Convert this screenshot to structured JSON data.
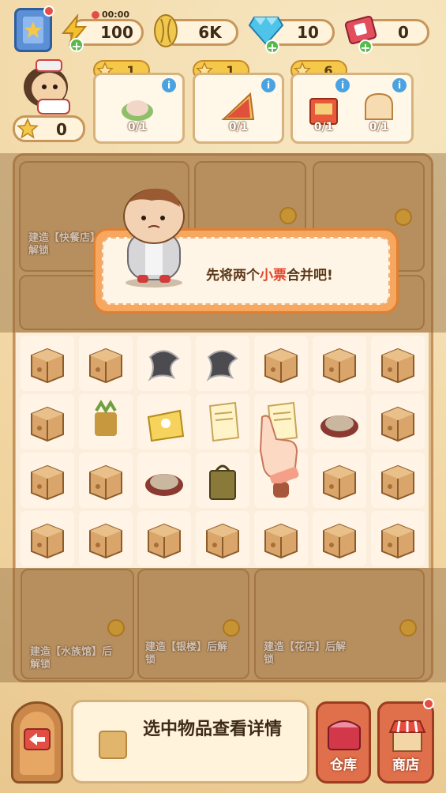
{
  "hud": {
    "energy": {
      "value": "100",
      "timer": "00:00"
    },
    "coins": {
      "value": "6K"
    },
    "gems": {
      "value": "10"
    },
    "tickets": {
      "value": "0"
    },
    "stars": {
      "value": "0"
    }
  },
  "orders": [
    {
      "stars": "1",
      "items": [
        {
          "count": "0/1"
        }
      ]
    },
    {
      "stars": "1",
      "items": [
        {
          "count": "0/1"
        }
      ]
    },
    {
      "stars": "6",
      "items": [
        {
          "count": "0/1"
        },
        {
          "count": "0/1"
        }
      ]
    }
  ],
  "locked_areas": {
    "top_left": "建造【快餐店】后解锁",
    "bottom_left": "建造【水族馆】后解锁",
    "bottom_mid": "建造【银楼】后解锁",
    "bottom_right": "建造【花店】后解锁"
  },
  "tutorial": {
    "message_prefix": "先将两个",
    "message_highlight": "小票",
    "message_suffix": "合并吧!"
  },
  "bottom": {
    "detail_text": "选中物品查看详情",
    "warehouse_label": "仓库",
    "shop_label": "商店"
  },
  "colors": {
    "accent": "#e2472f",
    "panel": "#fff4e6",
    "frame": "#c4925a"
  }
}
